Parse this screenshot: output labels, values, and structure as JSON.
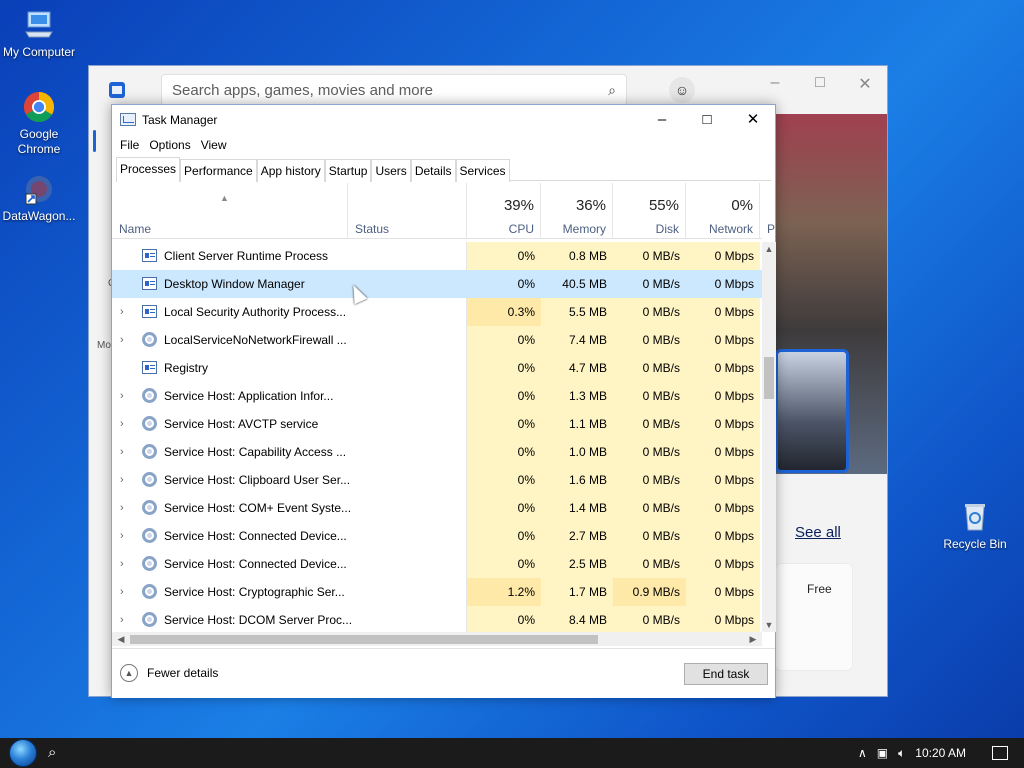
{
  "desktop": {
    "icons": [
      {
        "label": "My Computer"
      },
      {
        "label": "Google Chrome"
      },
      {
        "label": "DataWagon..."
      },
      {
        "label": "Recycle Bin"
      }
    ]
  },
  "store": {
    "search_placeholder": "Search apps, games, movies and more",
    "see_all": "See all",
    "free": "Free",
    "side_text_1": "C",
    "side_text_2": "Mo"
  },
  "taskmgr": {
    "title": "Task Manager",
    "menu": [
      "File",
      "Options",
      "View"
    ],
    "tabs": [
      "Processes",
      "Performance",
      "App history",
      "Startup",
      "Users",
      "Details",
      "Services"
    ],
    "columns": {
      "name": "Name",
      "status": "Status",
      "cpu": {
        "pct": "39%",
        "label": "CPU"
      },
      "memory": {
        "pct": "36%",
        "label": "Memory"
      },
      "disk": {
        "pct": "55%",
        "label": "Disk"
      },
      "network": {
        "pct": "0%",
        "label": "Network"
      },
      "power": "P"
    },
    "rows": [
      {
        "name": "Client Server Runtime Process",
        "cpu": "0%",
        "mem": "0.8 MB",
        "disk": "0 MB/s",
        "net": "0 Mbps"
      },
      {
        "name": "Desktop Window Manager",
        "cpu": "0%",
        "mem": "40.5 MB",
        "disk": "0 MB/s",
        "net": "0 Mbps"
      },
      {
        "name": "Local Security Authority Process...",
        "cpu": "0.3%",
        "mem": "5.5 MB",
        "disk": "0 MB/s",
        "net": "0 Mbps"
      },
      {
        "name": "LocalServiceNoNetworkFirewall ...",
        "cpu": "0%",
        "mem": "7.4 MB",
        "disk": "0 MB/s",
        "net": "0 Mbps"
      },
      {
        "name": "Registry",
        "cpu": "0%",
        "mem": "4.7 MB",
        "disk": "0 MB/s",
        "net": "0 Mbps"
      },
      {
        "name": "Service Host: Application Infor...",
        "cpu": "0%",
        "mem": "1.3 MB",
        "disk": "0 MB/s",
        "net": "0 Mbps"
      },
      {
        "name": "Service Host: AVCTP service",
        "cpu": "0%",
        "mem": "1.1 MB",
        "disk": "0 MB/s",
        "net": "0 Mbps"
      },
      {
        "name": "Service Host: Capability Access ...",
        "cpu": "0%",
        "mem": "1.0 MB",
        "disk": "0 MB/s",
        "net": "0 Mbps"
      },
      {
        "name": "Service Host: Clipboard User Ser...",
        "cpu": "0%",
        "mem": "1.6 MB",
        "disk": "0 MB/s",
        "net": "0 Mbps"
      },
      {
        "name": "Service Host: COM+ Event Syste...",
        "cpu": "0%",
        "mem": "1.4 MB",
        "disk": "0 MB/s",
        "net": "0 Mbps"
      },
      {
        "name": "Service Host: Connected Device...",
        "cpu": "0%",
        "mem": "2.7 MB",
        "disk": "0 MB/s",
        "net": "0 Mbps"
      },
      {
        "name": "Service Host: Connected Device...",
        "cpu": "0%",
        "mem": "2.5 MB",
        "disk": "0 MB/s",
        "net": "0 Mbps"
      },
      {
        "name": "Service Host: Cryptographic Ser...",
        "cpu": "1.2%",
        "mem": "1.7 MB",
        "disk": "0.9 MB/s",
        "net": "0 Mbps"
      },
      {
        "name": "Service Host: DCOM Server Proc...",
        "cpu": "0%",
        "mem": "8.4 MB",
        "disk": "0 MB/s",
        "net": "0 Mbps"
      }
    ],
    "footer": {
      "fewer_details": "Fewer details",
      "end_task": "End task"
    }
  },
  "taskbar": {
    "clock": "10:20 AM"
  }
}
